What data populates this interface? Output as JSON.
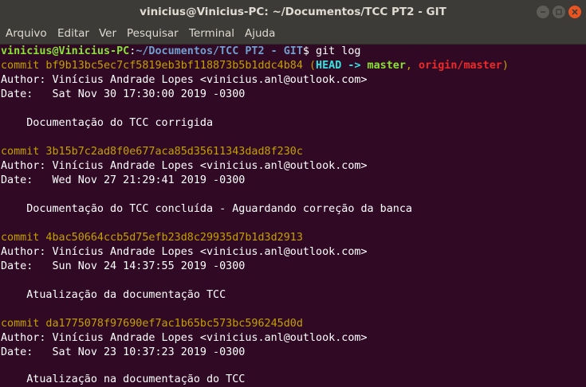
{
  "window": {
    "title": "vinicius@Vinicius-PC: ~/Documentos/TCC PT2 - GIT"
  },
  "menu": [
    "Arquivo",
    "Editar",
    "Ver",
    "Pesquisar",
    "Terminal",
    "Ajuda"
  ],
  "prompt": {
    "user_host": "vinicius@Vinicius-PC",
    "sep": ":",
    "path": "~/Documentos/TCC PT2 - GIT",
    "dollar": "$",
    "command": " git log"
  },
  "commits": [
    {
      "line": "commit bf9b13bc5ec7cf5819eb3bf118873b5b1ddc4b84",
      "refs": {
        "open": " (",
        "head": "HEAD -> ",
        "branch": "master",
        "comma": ", ",
        "remote": "origin/master",
        "close": ")"
      },
      "author": "Author: Vinícius Andrade Lopes <vinicius.anl@outlook.com>",
      "date": "Date:   Sat Nov 30 17:30:00 2019 -0300",
      "message": "    Documentação do TCC corrigida"
    },
    {
      "line": "commit 3b15b7c2ad8f0e677aca85d35611343dad8f230c",
      "author": "Author: Vinícius Andrade Lopes <vinicius.anl@outlook.com>",
      "date": "Date:   Wed Nov 27 21:29:41 2019 -0300",
      "message": "    Documentação do TCC concluída - Aguardando correção da banca"
    },
    {
      "line": "commit 4bac50664ccb5d75efb23d8c29935d7b1d3d2913",
      "author": "Author: Vinícius Andrade Lopes <vinicius.anl@outlook.com>",
      "date": "Date:   Sun Nov 24 14:37:55 2019 -0300",
      "message": "    Atualização da documentação TCC"
    },
    {
      "line": "commit da1775078f97690ef7ac1b65bc573bc596245d0d",
      "author": "Author: Vinícius Andrade Lopes <vinicius.anl@outlook.com>",
      "date": "Date:   Sat Nov 23 10:37:23 2019 -0300",
      "message": "    Atualização na documentação do TCC"
    }
  ],
  "colors": {
    "background": "#300a24",
    "prompt_user": "#8ae234",
    "prompt_path": "#729fcf",
    "commit_hash": "#c4a000",
    "head_ref": "#34e2e2",
    "remote_ref": "#ef2929",
    "chrome": "#3c3b37"
  }
}
